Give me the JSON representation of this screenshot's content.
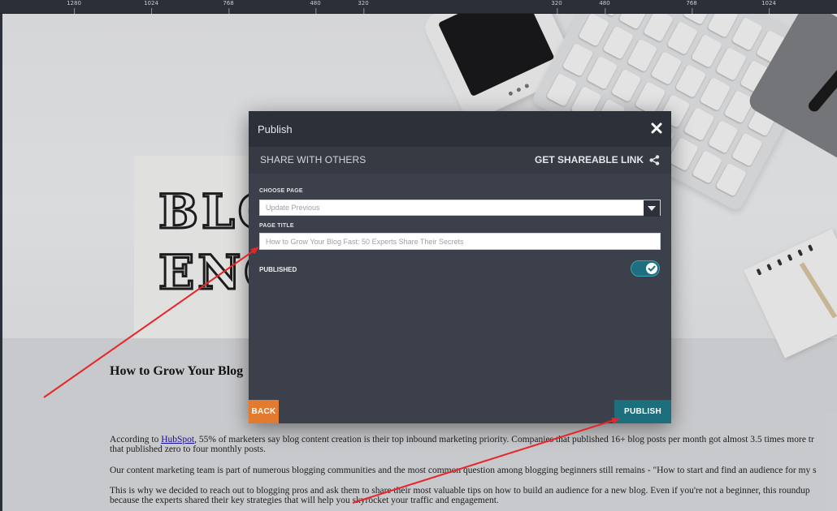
{
  "ruler": {
    "ticks": [
      "1280",
      "1024",
      "768",
      "480",
      "320",
      "320",
      "480",
      "768",
      "1024"
    ]
  },
  "hero": {
    "word_line1": "BLO",
    "word_line2": "ENG"
  },
  "article": {
    "title": "How to Grow Your Blog",
    "p1_start": "According to ",
    "p1_link": "HubSpot",
    "p1_rest": ", 55% of marketers say blog content creation is their top inbound marketing priority. Companies that published 16+ blog posts per month got almost 3.5 times more tr",
    "p1_line2": "that published zero to four monthly posts.",
    "p2": "Our content marketing team is part of numerous blogging communities and the most common question among blogging beginners still remains - \"How to start and find an audience for my s",
    "p3_line1": "This is why we decided to reach out to blogging pros and ask them to share their most valuable tips on how to build an audience for a new blog. Even if you're not a beginner, this roundup",
    "p3_line2": "because the experts shared their key strategies that will help you skyrocket your traffic and engagement."
  },
  "modal": {
    "title": "Publish",
    "share_label": "SHARE WITH OTHERS",
    "link_label": "GET SHAREABLE LINK",
    "choose_page_label": "CHOOSE PAGE",
    "choose_page_value": "Update Previous",
    "page_title_label": "PAGE TITLE",
    "page_title_placeholder": "How to Grow Your Blog Fast: 50 Experts Share Their Secrets",
    "published_label": "PUBLISHED",
    "published_on": true,
    "back_label": "BACK",
    "publish_label": "PUBLISH"
  },
  "colors": {
    "modal_bg": "#3b404a",
    "header_bg": "#2c3038",
    "back_button": "#e27a2f",
    "publish_button": "#1e6f7d",
    "toggle_on": "#1d6e7e",
    "arrow": "#e8262a"
  },
  "icons": {
    "close": "close-icon",
    "share": "share-icon",
    "dropdown": "chevron-down-icon",
    "check": "check-icon"
  }
}
